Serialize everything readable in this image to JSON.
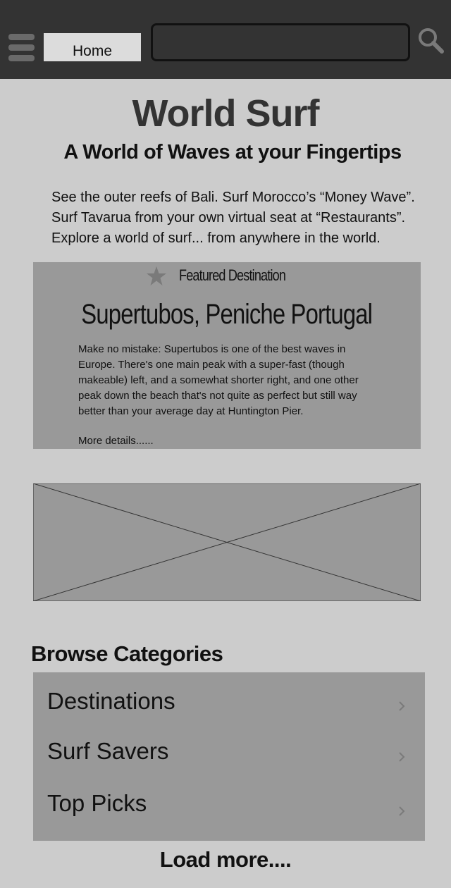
{
  "header": {
    "menu_icon": "hamburger-menu-icon",
    "home_label": "Home",
    "search": {
      "value": "",
      "placeholder": "",
      "icon": "search-icon"
    }
  },
  "hero": {
    "title": "World Surf",
    "subtitle": "A World of Waves at your Fingertips",
    "intro_lines": [
      "See the outer reefs of Bali. Surf Morocco’s “Money Wave”.",
      "Surf Tavarua from your own virtual seat at “Restaurants”.",
      "Explore a world of surf... from anywhere in the world."
    ]
  },
  "featured": {
    "icon": "star-icon",
    "label": "Featured Destination",
    "title": "Supertubos, Peniche Portugal",
    "description_lines": [
      "Make no mistake: Supertubos is one of the best waves in",
      "Europe. There's one main peak with a super-fast (though",
      "makeable) left, and a somewhat shorter right, and one other",
      "peak down the beach that's not quite as perfect but still way",
      "better than your average day at Huntington Pier."
    ],
    "more_link": "More details......"
  },
  "image_placeholder": {
    "icon": "image-placeholder-x"
  },
  "browse": {
    "heading": "Browse Categories",
    "items": [
      {
        "label": "Destinations",
        "icon": "chevron-right-icon"
      },
      {
        "label": "Surf Savers",
        "icon": "chevron-right-icon"
      },
      {
        "label": "Top Picks",
        "icon": "chevron-right-icon"
      }
    ]
  },
  "footer": {
    "load_more": "Load more...."
  },
  "colors": {
    "header_bg": "#333333",
    "page_bg": "#cccccc",
    "panel_bg": "#999999",
    "home_button_bg": "#dcdcdc",
    "title_color": "#333333",
    "text_color": "#111111"
  }
}
